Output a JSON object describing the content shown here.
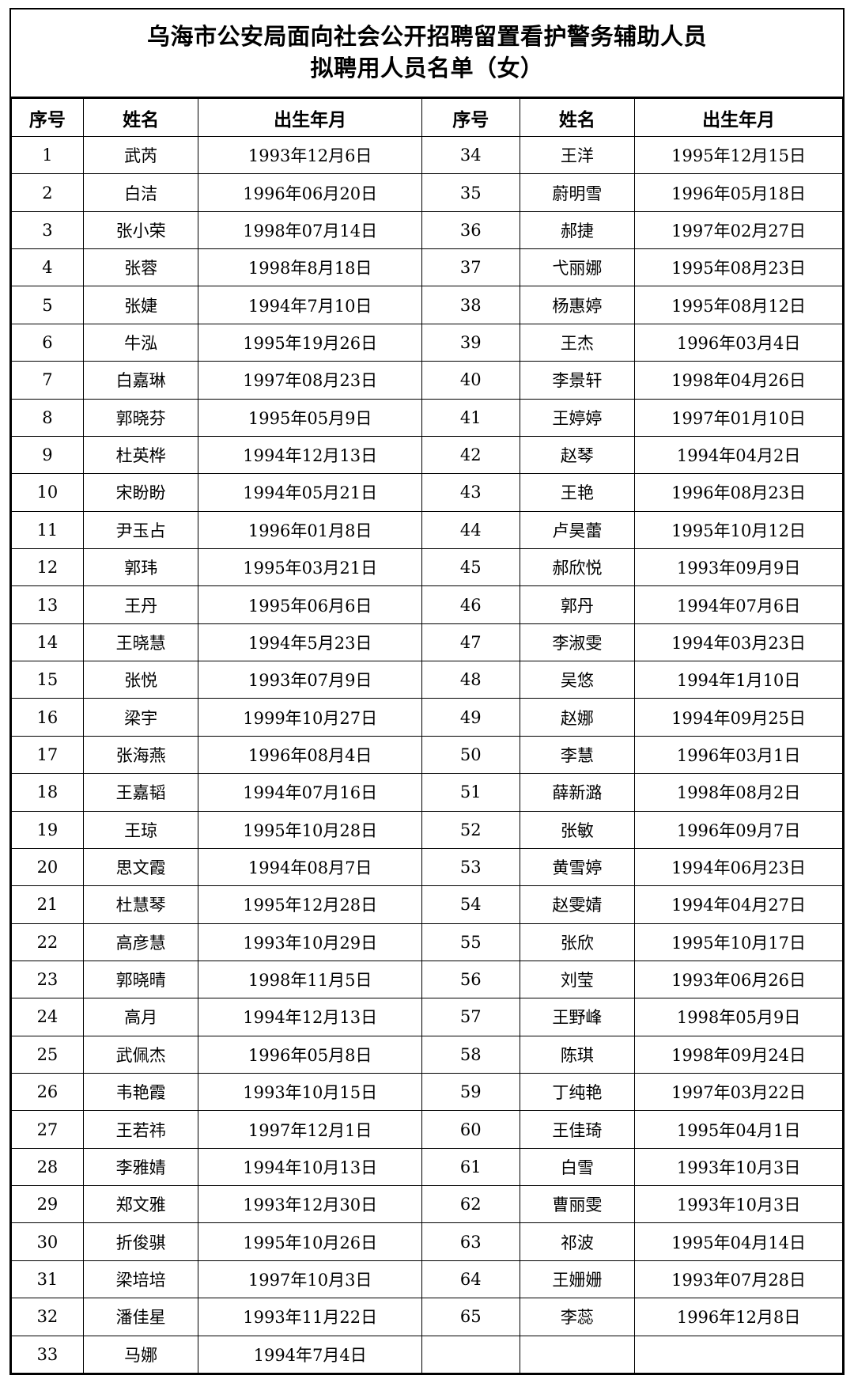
{
  "document": {
    "title_line_1": "乌海市公安局面向社会公开招聘留置看护警务辅助人员",
    "title_line_2": "拟聘用人员名单（女）"
  },
  "table": {
    "headers": [
      "序号",
      "姓名",
      "出生年月",
      "序号",
      "姓名",
      "出生年月"
    ],
    "rows": [
      [
        "1",
        "武芮",
        "1993年12月6日",
        "34",
        "王洋",
        "1995年12月15日"
      ],
      [
        "2",
        "白洁",
        "1996年06月20日",
        "35",
        "蔚明雪",
        "1996年05月18日"
      ],
      [
        "3",
        "张小荣",
        "1998年07月14日",
        "36",
        "郝捷",
        "1997年02月27日"
      ],
      [
        "4",
        "张蓉",
        "1998年8月18日",
        "37",
        "弋丽娜",
        "1995年08月23日"
      ],
      [
        "5",
        "张婕",
        "1994年7月10日",
        "38",
        "杨惠婷",
        "1995年08月12日"
      ],
      [
        "6",
        "牛泓",
        "1995年19月26日",
        "39",
        "王杰",
        "1996年03月4日"
      ],
      [
        "7",
        "白嘉琳",
        "1997年08月23日",
        "40",
        "李景轩",
        "1998年04月26日"
      ],
      [
        "8",
        "郭晓芬",
        "1995年05月9日",
        "41",
        "王婷婷",
        "1997年01月10日"
      ],
      [
        "9",
        "杜英桦",
        "1994年12月13日",
        "42",
        "赵琴",
        "1994年04月2日"
      ],
      [
        "10",
        "宋盼盼",
        "1994年05月21日",
        "43",
        "王艳",
        "1996年08月23日"
      ],
      [
        "11",
        "尹玉占",
        "1996年01月8日",
        "44",
        "卢昊蕾",
        "1995年10月12日"
      ],
      [
        "12",
        "郭玮",
        "1995年03月21日",
        "45",
        "郝欣悦",
        "1993年09月9日"
      ],
      [
        "13",
        "王丹",
        "1995年06月6日",
        "46",
        "郭丹",
        "1994年07月6日"
      ],
      [
        "14",
        "王晓慧",
        "1994年5月23日",
        "47",
        "李淑雯",
        "1994年03月23日"
      ],
      [
        "15",
        "张悦",
        "1993年07月9日",
        "48",
        "吴悠",
        "1994年1月10日"
      ],
      [
        "16",
        "梁宇",
        "1999年10月27日",
        "49",
        "赵娜",
        "1994年09月25日"
      ],
      [
        "17",
        "张海燕",
        "1996年08月4日",
        "50",
        "李慧",
        "1996年03月1日"
      ],
      [
        "18",
        "王嘉韬",
        "1994年07月16日",
        "51",
        "薛新潞",
        "1998年08月2日"
      ],
      [
        "19",
        "王琼",
        "1995年10月28日",
        "52",
        "张敏",
        "1996年09月7日"
      ],
      [
        "20",
        "思文霞",
        "1994年08月7日",
        "53",
        "黄雪婷",
        "1994年06月23日"
      ],
      [
        "21",
        "杜慧琴",
        "1995年12月28日",
        "54",
        "赵雯婧",
        "1994年04月27日"
      ],
      [
        "22",
        "高彦慧",
        "1993年10月29日",
        "55",
        "张欣",
        "1995年10月17日"
      ],
      [
        "23",
        "郭晓晴",
        "1998年11月5日",
        "56",
        "刘莹",
        "1993年06月26日"
      ],
      [
        "24",
        "高月",
        "1994年12月13日",
        "57",
        "王野峰",
        "1998年05月9日"
      ],
      [
        "25",
        "武佩杰",
        "1996年05月8日",
        "58",
        "陈琪",
        "1998年09月24日"
      ],
      [
        "26",
        "韦艳霞",
        "1993年10月15日",
        "59",
        "丁纯艳",
        "1997年03月22日"
      ],
      [
        "27",
        "王若祎",
        "1997年12月1日",
        "60",
        "王佳琦",
        "1995年04月1日"
      ],
      [
        "28",
        "李雅婧",
        "1994年10月13日",
        "61",
        "白雪",
        "1993年10月3日"
      ],
      [
        "29",
        "郑文雅",
        "1993年12月30日",
        "62",
        "曹丽雯",
        "1993年10月3日"
      ],
      [
        "30",
        "折俊骐",
        "1995年10月26日",
        "63",
        "祁波",
        "1995年04月14日"
      ],
      [
        "31",
        "梁培培",
        "1997年10月3日",
        "64",
        "王姗姗",
        "1993年07月28日"
      ],
      [
        "32",
        "潘佳星",
        "1993年11月22日",
        "65",
        "李蕊",
        "1996年12月8日"
      ],
      [
        "33",
        "马娜",
        "1994年7月4日",
        "",
        "",
        ""
      ]
    ]
  }
}
